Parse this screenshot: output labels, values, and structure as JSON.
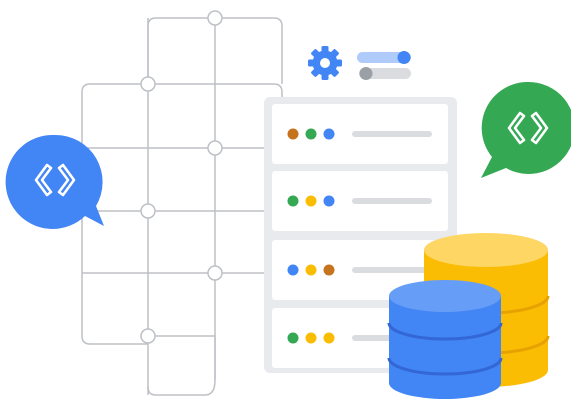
{
  "colors": {
    "grid_line": "#bdc1c6",
    "panel_bg": "#e8eaed",
    "card_bg": "#ffffff",
    "card_line": "#dadce0",
    "blue": "#4285f4",
    "blue_dark": "#3367d6",
    "green": "#34a853",
    "yellow": "#fbbc04",
    "yellow_dark": "#e8a200",
    "brown": "#c5731c",
    "gray_knob": "#9aa0a6",
    "toggle_track_on": "#aecbfa",
    "toggle_track_off": "#dadce0"
  },
  "server_rows": [
    {
      "dots": [
        "brown",
        "green",
        "blue"
      ]
    },
    {
      "dots": [
        "green",
        "yellow",
        "blue"
      ]
    },
    {
      "dots": [
        "blue",
        "yellow",
        "brown"
      ]
    },
    {
      "dots": [
        "green",
        "yellow",
        "yellow"
      ]
    }
  ],
  "toggles": [
    {
      "state": "on"
    },
    {
      "state": "off"
    }
  ],
  "icons": {
    "settings": "gear-icon",
    "left_bubble": "code-brackets-icon",
    "right_bubble": "code-brackets-icon",
    "databases": "database-icon"
  }
}
